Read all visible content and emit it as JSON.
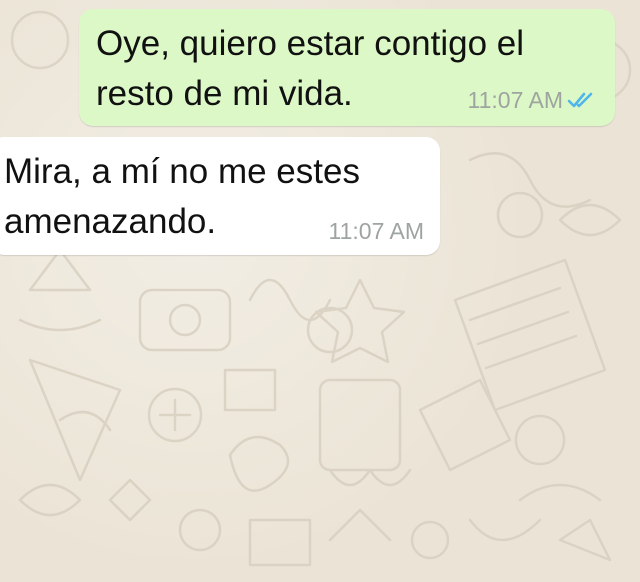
{
  "conversation": {
    "messages": [
      {
        "direction": "outgoing",
        "lines": [
          "Oye, quiero estar contigo el",
          "resto de mi vida."
        ],
        "time": "11:07 AM",
        "status_icon": "double-check-read-icon"
      },
      {
        "direction": "incoming",
        "lines": [
          "Mira, a mí no me estes",
          "amenazando."
        ],
        "time": "11:07 AM"
      }
    ]
  },
  "colors": {
    "background": "#ebe4d6",
    "outgoing_bubble": "#dcf8c6",
    "incoming_bubble": "#ffffff",
    "timestamp": "#9ea4a0",
    "read_check": "#4fb6ec"
  }
}
